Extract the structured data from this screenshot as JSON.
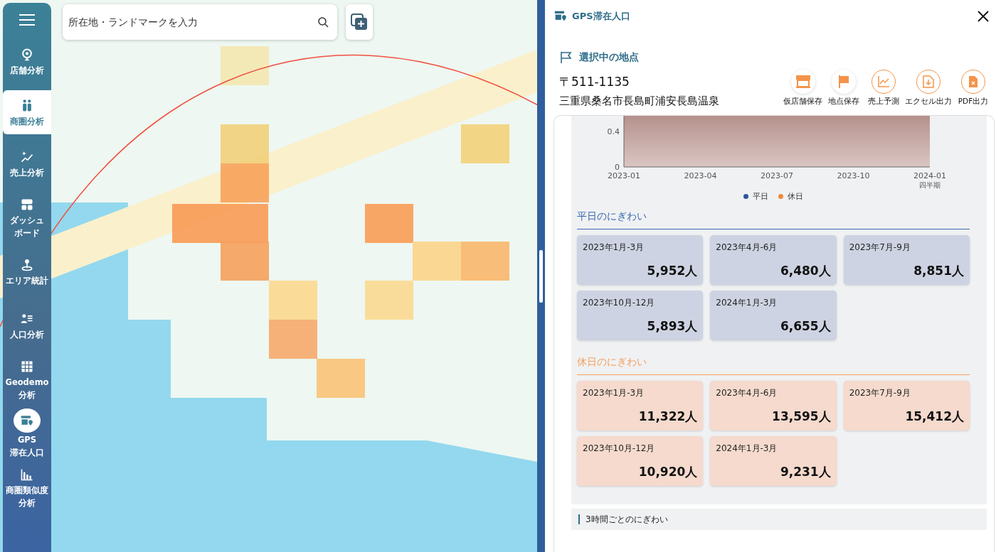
{
  "map": {
    "search": {
      "placeholder": "所在地・ランドマークを入力"
    }
  },
  "sidebar": {
    "items": [
      {
        "lines": [
          "店舗分析"
        ],
        "selected": false,
        "open": false
      },
      {
        "lines": [
          "商圏分析"
        ],
        "selected": true,
        "open": false
      },
      {
        "lines": [
          "売上分析"
        ],
        "selected": false,
        "open": false
      },
      {
        "lines": [
          "ダッシュ",
          "ボード"
        ],
        "selected": false,
        "open": false
      },
      {
        "lines": [
          "エリア統計"
        ],
        "selected": false,
        "open": false
      },
      {
        "lines": [
          "人口分析"
        ],
        "selected": false,
        "open": false
      },
      {
        "lines": [
          "Geodemo",
          "分析"
        ],
        "selected": false,
        "open": false
      },
      {
        "lines": [
          "GPS",
          "滞在人口"
        ],
        "selected": false,
        "open": true
      },
      {
        "lines": [
          "商圏類似度",
          "分析"
        ],
        "selected": false,
        "open": false
      }
    ]
  },
  "panel": {
    "title": "GPS滞在人口",
    "location_heading": "選択中の地点",
    "postal_code": "〒511-1135",
    "address": "三重県桑名市長島町浦安長島温泉",
    "actions": [
      {
        "label": "仮店舗保存",
        "kind": "store"
      },
      {
        "label": "地点保存",
        "kind": "flag"
      },
      {
        "label": "売上予測",
        "kind": "chart"
      },
      {
        "label": "エクセル出力",
        "kind": "download"
      },
      {
        "label": "PDF出力",
        "kind": "pdf"
      }
    ],
    "chart": {
      "yticks": [
        "0.4",
        "0"
      ],
      "xticks": [
        "2023-01",
        "2023-04",
        "2023-07",
        "2023-10",
        "2024-01"
      ],
      "x_unit": "四半期",
      "legend": [
        {
          "label": "平日",
          "color": "#2f5597"
        },
        {
          "label": "休日",
          "color": "#f08a3c"
        }
      ]
    },
    "sections": [
      {
        "kind": "weekday",
        "title": "平日のにぎわい",
        "cards": [
          {
            "period": "2023年1月-3月",
            "value": "5,952人"
          },
          {
            "period": "2023年4月-6月",
            "value": "6,480人"
          },
          {
            "period": "2023年7月-9月",
            "value": "8,851人"
          },
          {
            "period": "2023年10月-12月",
            "value": "5,893人"
          },
          {
            "period": "2024年1月-3月",
            "value": "6,655人"
          }
        ]
      },
      {
        "kind": "holiday",
        "title": "休日のにぎわい",
        "cards": [
          {
            "period": "2023年1月-3月",
            "value": "11,322人"
          },
          {
            "period": "2023年4月-6月",
            "value": "13,595人"
          },
          {
            "period": "2023年7月-9月",
            "value": "15,412人"
          },
          {
            "period": "2023年10月-12月",
            "value": "10,920人"
          },
          {
            "period": "2024年1月-3月",
            "value": "9,231人"
          }
        ]
      }
    ],
    "next_section": "3時間ごとのにぎわい"
  }
}
